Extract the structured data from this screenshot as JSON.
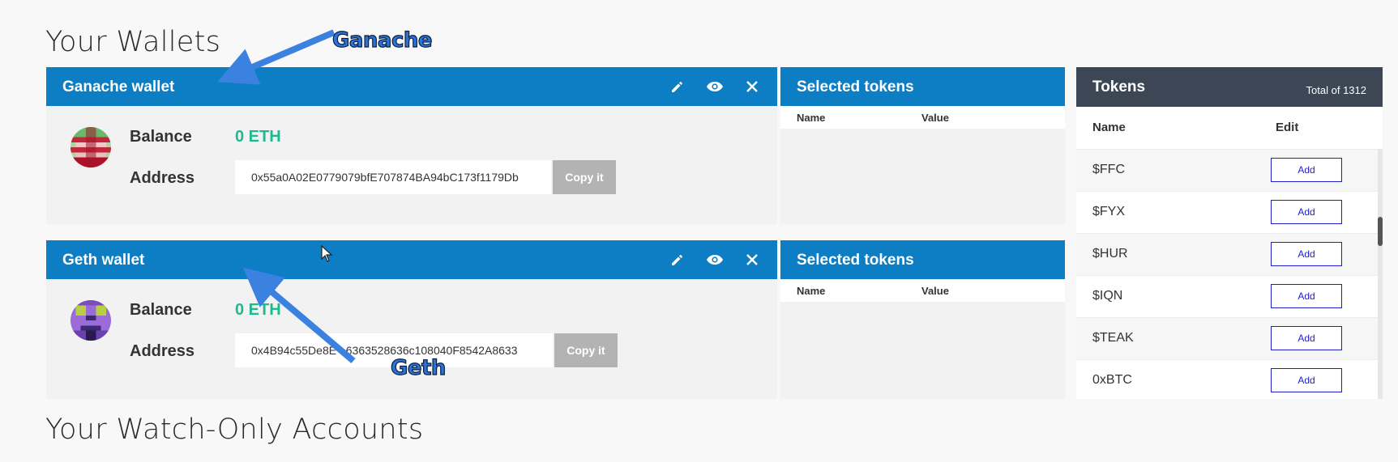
{
  "page": {
    "title": "Your Wallets",
    "watch_only_title": "Your Watch-Only Accounts"
  },
  "wallets": [
    {
      "name": "Ganache wallet",
      "balance_label": "Balance",
      "balance": "0 ETH",
      "address_label": "Address",
      "address": "0x55a0A02E0779079bfE707874BA94bC173f1179Db",
      "copy_label": "Copy it"
    },
    {
      "name": "Geth wallet",
      "balance_label": "Balance",
      "balance": "0 ETH",
      "address_label": "Address",
      "address": "0x4B94c55De8E   6363528636c108040F8542A8633",
      "copy_label": "Copy it"
    }
  ],
  "selected_tokens": {
    "title": "Selected tokens",
    "col_name": "Name",
    "col_value": "Value"
  },
  "tokens": {
    "title": "Tokens",
    "total": "Total of 1312",
    "col_name": "Name",
    "col_edit": "Edit",
    "add_label": "Add",
    "items": [
      "$FFC",
      "$FYX",
      "$HUR",
      "$IQN",
      "$TEAK",
      "0xBTC"
    ]
  },
  "annotations": {
    "ganache": "Ganache",
    "geth": "Geth"
  },
  "colors": {
    "header_blue": "#0d7dc4",
    "tokens_header": "#3c4654",
    "balance_green": "#1fb98f",
    "annotation_blue": "#2b73d8"
  },
  "icons": [
    "pencil-icon",
    "eye-icon",
    "close-icon",
    "mouse-cursor-icon",
    "arrow-icon"
  ]
}
